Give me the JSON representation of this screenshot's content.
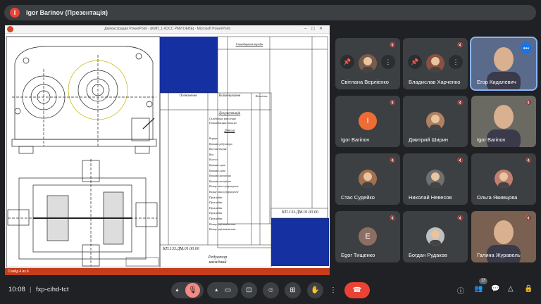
{
  "header": {
    "presenter_label": "Igor Barinov (Презентація)",
    "indicator_letter": "I"
  },
  "presentation": {
    "window_title": "Демонстрация PowerPoint - [КМП_1 КОСС РМИ DEBE] - Microsoft PowerPoint",
    "status_text": "Слайд 4 из 6",
    "spec_header": [
      "Позначення",
      "Найменування",
      "Кількість"
    ],
    "spec_documentation": "Документація",
    "spec_documentation_rows": [
      "Складальне креслення",
      "Пояснювальна записка"
    ],
    "spec_details": "Деталі",
    "spec_detail_rows": [
      "Корпус",
      "Кришка редуктора",
      "Вал-шестерня",
      "Вал",
      "Колесо",
      "Кришка глуха",
      "Кришка глуха",
      "Кришка наскрізна",
      "Кришка наскрізна",
      "Кільце маслоутримуюче",
      "Кільце маслоутримуюче",
      "Прокладка",
      "Прокладка",
      "Прокладка",
      "Прокладка",
      "Прокладка",
      "Кільце ущільнювальне",
      "Кільце ущільнювальне"
    ],
    "spec_right_header": "Стандартні вироби",
    "stamp_code": "КП.133.ДМ.01.00.00",
    "stamp_title": "Редуктор\nкасадний",
    "stamp_code_2": "КП.133.ДМ.01.00.00"
  },
  "participants": [
    {
      "name": "Світлана Верлієнко",
      "type": "avatar-photo",
      "color": "#7a5b4a"
    },
    {
      "name": "Владислав Харченко",
      "type": "avatar-photo",
      "color": "#8a5040"
    },
    {
      "name": "Егор Кидалевич",
      "type": "video",
      "color": "#5a6a8a"
    },
    {
      "name": "Igor Barinov",
      "type": "letter",
      "letter": "I",
      "color": "#ef6c35"
    },
    {
      "name": "Дмитрий Ширин",
      "type": "avatar-photo",
      "color": "#b08060"
    },
    {
      "name": "Igor Barinov",
      "type": "video",
      "color": "#6b6a62"
    },
    {
      "name": "Стас Судейко",
      "type": "avatar-photo",
      "color": "#a07050"
    },
    {
      "name": "Николай Невесов",
      "type": "avatar-photo",
      "color": "#707070"
    },
    {
      "name": "Ольга Якимцова",
      "type": "avatar-photo",
      "color": "#c08070"
    },
    {
      "name": "Egor Тищенко",
      "type": "letter",
      "letter": "E",
      "color": "#8d6e63"
    },
    {
      "name": "Богдан Рудаков",
      "type": "avatar-photo",
      "color": "#c0c0c0"
    },
    {
      "name": "Галина Журавель",
      "type": "video",
      "color": "#7a6050"
    }
  ],
  "footer": {
    "time": "10:08",
    "separator": "|",
    "meeting_code": "fxp-cihd-tct",
    "participant_count": "13"
  },
  "colors": {
    "end_call": "#ea4335",
    "muted": "#f28b82",
    "accent": "#8ab4f8",
    "tile": "#3c4043"
  }
}
